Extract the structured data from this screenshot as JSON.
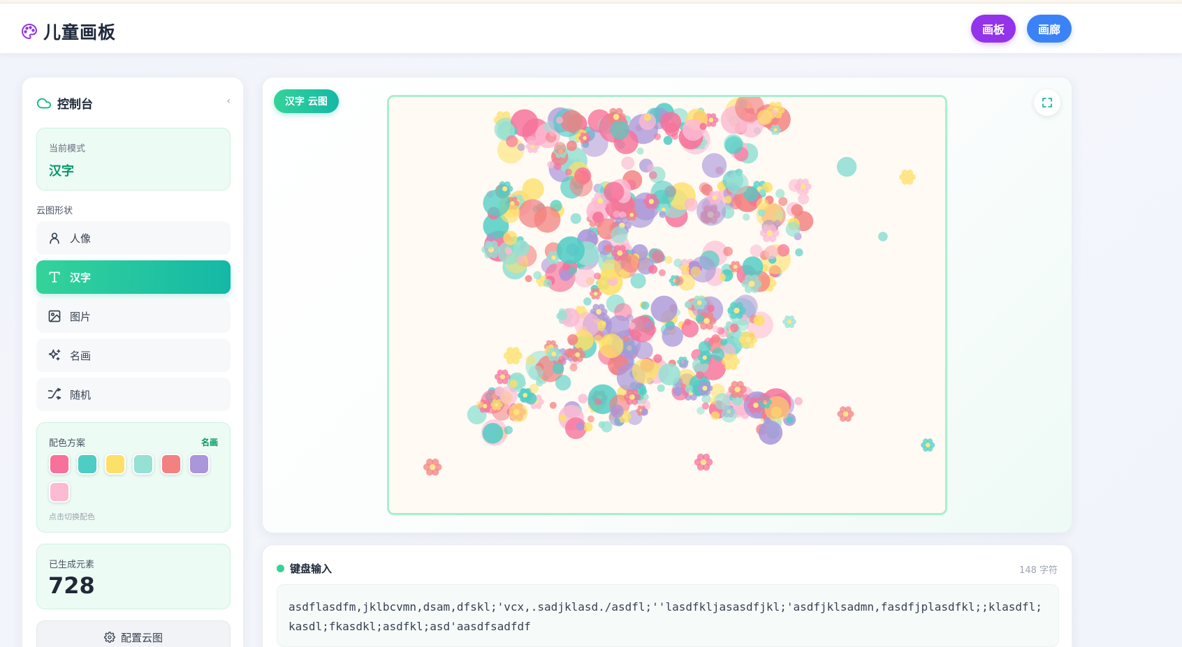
{
  "header": {
    "app_title": "儿童画板",
    "logo_icon": "palette-icon",
    "nav": [
      {
        "label": "画板",
        "color": "#9333ea"
      },
      {
        "label": "画廊",
        "color": "#3b82f6"
      }
    ]
  },
  "sidebar": {
    "title": "控制台",
    "title_icon": "cloud-icon",
    "collapse_label": "‹",
    "current_mode_label": "当前模式",
    "current_mode_value": "汉字",
    "shape_section_title": "云图形状",
    "shapes": [
      {
        "label": "人像",
        "icon": "user-icon",
        "active": false
      },
      {
        "label": "汉字",
        "icon": "text-icon",
        "active": true
      },
      {
        "label": "图片",
        "icon": "image-icon",
        "active": false
      },
      {
        "label": "名画",
        "icon": "sparkles-icon",
        "active": false
      },
      {
        "label": "随机",
        "icon": "shuffle-icon",
        "active": false
      }
    ],
    "palette": {
      "label": "配色方案",
      "scheme_name": "名画",
      "colors": [
        "#f7719a",
        "#4ecdc4",
        "#fde068",
        "#95e1d3",
        "#f38181",
        "#aa96da",
        "#fcbad3"
      ],
      "hint": "点击切换配色"
    },
    "generated_label": "已生成元素",
    "generated_count": "728",
    "config_button": "配置云图",
    "config_icon": "gear-icon"
  },
  "canvas": {
    "mode_badge": "汉字 云图",
    "fullscreen_icon": "fullscreen-icon",
    "character_glyph": "爱",
    "frame_border_color": "#a7f0cf"
  },
  "keyboard_input": {
    "label": "键盘输入",
    "char_count": "148 字符",
    "text": "asdflasdfm,jklbcvmn,dsam,dfskl;'vcx,.sadjklasd./asdfl;''lasdfkljasasdfjkl;'asdfjklsadmn,fasdfjplasdfkl;;klasdfl;kasdl;fkasdkl;asdfkl;asd'aasdfsadfdf"
  }
}
